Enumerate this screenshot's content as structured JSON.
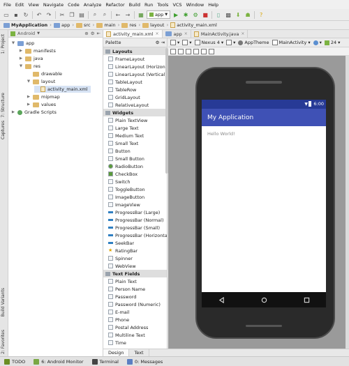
{
  "menu": [
    "File",
    "Edit",
    "View",
    "Navigate",
    "Code",
    "Analyze",
    "Refactor",
    "Build",
    "Run",
    "Tools",
    "VCS",
    "Window",
    "Help"
  ],
  "toolbar": {
    "run_config": "app"
  },
  "breadcrumb": [
    "MyApplication",
    "app",
    "src",
    "main",
    "res",
    "layout",
    "activity_main.xml"
  ],
  "project_panel": {
    "view_mode": "Android",
    "tree": [
      {
        "label": "app",
        "depth": 0,
        "arrow": "▼",
        "icon": "folder-blue"
      },
      {
        "label": "manifests",
        "depth": 1,
        "arrow": "▶",
        "icon": "folder"
      },
      {
        "label": "java",
        "depth": 1,
        "arrow": "▶",
        "icon": "folder"
      },
      {
        "label": "res",
        "depth": 1,
        "arrow": "▼",
        "icon": "folder"
      },
      {
        "label": "drawable",
        "depth": 2,
        "arrow": "",
        "icon": "folder"
      },
      {
        "label": "layout",
        "depth": 2,
        "arrow": "▼",
        "icon": "folder"
      },
      {
        "label": "activity_main.xml",
        "depth": 3,
        "arrow": "",
        "icon": "xml"
      },
      {
        "label": "mipmap",
        "depth": 2,
        "arrow": "▶",
        "icon": "folder"
      },
      {
        "label": "values",
        "depth": 2,
        "arrow": "▶",
        "icon": "folder"
      },
      {
        "label": "Gradle Scripts",
        "depth": 0,
        "arrow": "▶",
        "icon": "gradle"
      }
    ]
  },
  "left_strip": [
    "1: Project",
    "7: Structure",
    "Captures",
    "Build Variants",
    "2: Favorites"
  ],
  "editor_tabs": [
    {
      "label": "activity_main.xml",
      "active": true
    },
    {
      "label": "app",
      "active": false
    },
    {
      "label": "MainActivity.java",
      "active": false
    }
  ],
  "palette": {
    "title": "Palette",
    "groups": [
      {
        "name": "Layouts",
        "items": [
          "FrameLayout",
          "LinearLayout (Horizontal)",
          "LinearLayout (Vertical)",
          "TableLayout",
          "TableRow",
          "GridLayout",
          "RelativeLayout"
        ]
      },
      {
        "name": "Widgets",
        "items": [
          "Plain TextView",
          "Large Text",
          "Medium Text",
          "Small Text",
          "Button",
          "Small Button",
          "RadioButton",
          "CheckBox",
          "Switch",
          "ToggleButton",
          "ImageButton",
          "ImageView",
          "ProgressBar (Large)",
          "ProgressBar (Normal)",
          "ProgressBar (Small)",
          "ProgressBar (Horizontal)",
          "SeekBar",
          "RatingBar",
          "Spinner",
          "WebView"
        ]
      },
      {
        "name": "Text Fields",
        "items": [
          "Plain Text",
          "Person Name",
          "Password",
          "Password (Numeric)",
          "E-mail",
          "Phone",
          "Postal Address",
          "Multiline Text",
          "Time"
        ]
      }
    ]
  },
  "design_toolbar": {
    "device": "Nexus 4",
    "theme": "AppTheme",
    "activity": "MainActivity",
    "api": "24"
  },
  "preview": {
    "status_time": "6:00",
    "app_title": "My Application",
    "content_text": "Hello World!"
  },
  "bottom_tabs": [
    {
      "label": "Design",
      "active": true
    },
    {
      "label": "Text",
      "active": false
    }
  ],
  "status_bar": [
    {
      "label": "TODO",
      "color": "#6b8e23"
    },
    {
      "label": "6: Android Monitor",
      "color": "#7aa844"
    },
    {
      "label": "Terminal",
      "color": "#444444"
    },
    {
      "label": "0: Messages",
      "color": "#5b7fc2"
    }
  ]
}
